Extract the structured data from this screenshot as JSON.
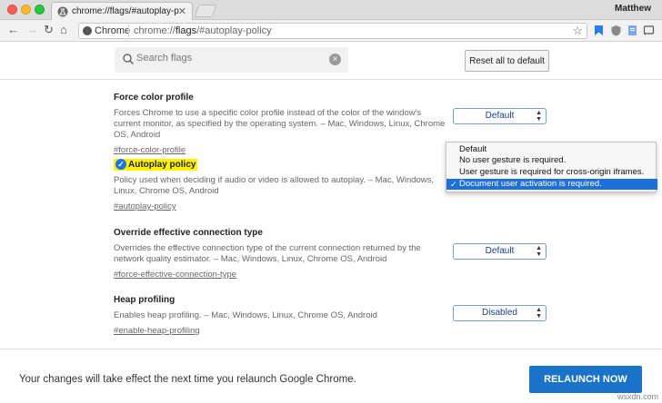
{
  "window": {
    "tab_title": "chrome://flags/#autoplay-polic",
    "tab_close": "✕",
    "profile_name": "Matthew"
  },
  "toolbar": {
    "site_chip": "Chrome",
    "url_prefix": "chrome://",
    "url_host": "flags",
    "url_path": "/#autoplay-policy"
  },
  "header": {
    "search_placeholder": "Search flags",
    "reset_label": "Reset all to default"
  },
  "experiments": [
    {
      "title": "Force color profile",
      "description": "Forces Chrome to use a specific color profile instead of the color of the window's current monitor, as specified by the operating system. – Mac, Windows, Linux, Chrome OS, Android",
      "link": "#force-color-profile",
      "value": "Default"
    },
    {
      "title": "Autoplay policy",
      "description": "Policy used when deciding if audio or video is allowed to autoplay. – Mac, Windows, Linux, Chrome OS, Android",
      "link": "#autoplay-policy",
      "value": "Document user activation is required."
    },
    {
      "title": "Override effective connection type",
      "description": "Overrides the effective connection type of the current connection returned by the network quality estimator. – Mac, Windows, Linux, Chrome OS, Android",
      "link": "#force-effective-connection-type",
      "value": "Default"
    },
    {
      "title": "Heap profiling",
      "description": "Enables heap profiling. – Mac, Windows, Linux, Chrome OS, Android",
      "link": "#enable-heap-profiling",
      "value": "Disabled"
    }
  ],
  "dropdown": {
    "options": [
      "Default",
      "No user gesture is required.",
      "User gesture is required for cross-origin iframes.",
      "Document user activation is required."
    ],
    "selected_index": 3,
    "check": "✓"
  },
  "footer": {
    "message": "Your changes will take effect the next time you relaunch Google Chrome.",
    "relaunch_label": "RELAUNCH NOW"
  },
  "watermark": "wsxdn.com",
  "colors": {
    "accent": "#1a73c8",
    "highlight": "#fff200",
    "selected_option": "#1f6fd6"
  }
}
